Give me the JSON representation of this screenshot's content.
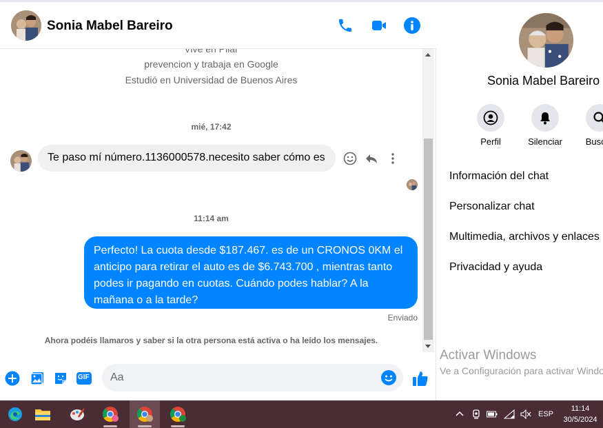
{
  "colors": {
    "accent": "#0084ff",
    "taskbar": "#4a2c35"
  },
  "contact": {
    "name": "Sonia Mabel Bareiro"
  },
  "header_icons": [
    "phone-icon",
    "video-camera-icon",
    "info-icon"
  ],
  "profile_lines": [
    "Vive en Pilar",
    "prevencion y trabaja en Google",
    "Estudió en Universidad de Buenos Aires"
  ],
  "messages": {
    "timestamp1": "mié, 17:42",
    "incoming": "Te paso mí número.1136000578.necesito saber cómo es",
    "timestamp2": "11:14 am",
    "outgoing": "Perfecto! La cuota desde $187.467. es de un CRONOS 0KM el anticipo para retirar el auto es de $6.743.700 , mientras tanto podes ir pagando en cuotas. Cuándo podes hablar? A la mañana o a la tarde?",
    "status": "Enviado",
    "notice": "Ahora podéis llamaros y saber si la otra persona está activa o ha leído los mensajes."
  },
  "composer": {
    "placeholder": "Aa",
    "gif_label": "GIF"
  },
  "info_pane": {
    "name": "Sonia Mabel Bareiro",
    "actions": [
      "Perfil",
      "Silenciar",
      "Buscar"
    ],
    "menu": [
      "Información del chat",
      "Personalizar chat",
      "Multimedia, archivos y enlaces",
      "Privacidad y ayuda"
    ]
  },
  "watermark": {
    "title": "Activar Windows",
    "subtitle": "Ve a Configuración para activar Windows."
  },
  "taskbar": {
    "lang": "ESP",
    "time": "11:14",
    "date": "30/5/2024"
  }
}
